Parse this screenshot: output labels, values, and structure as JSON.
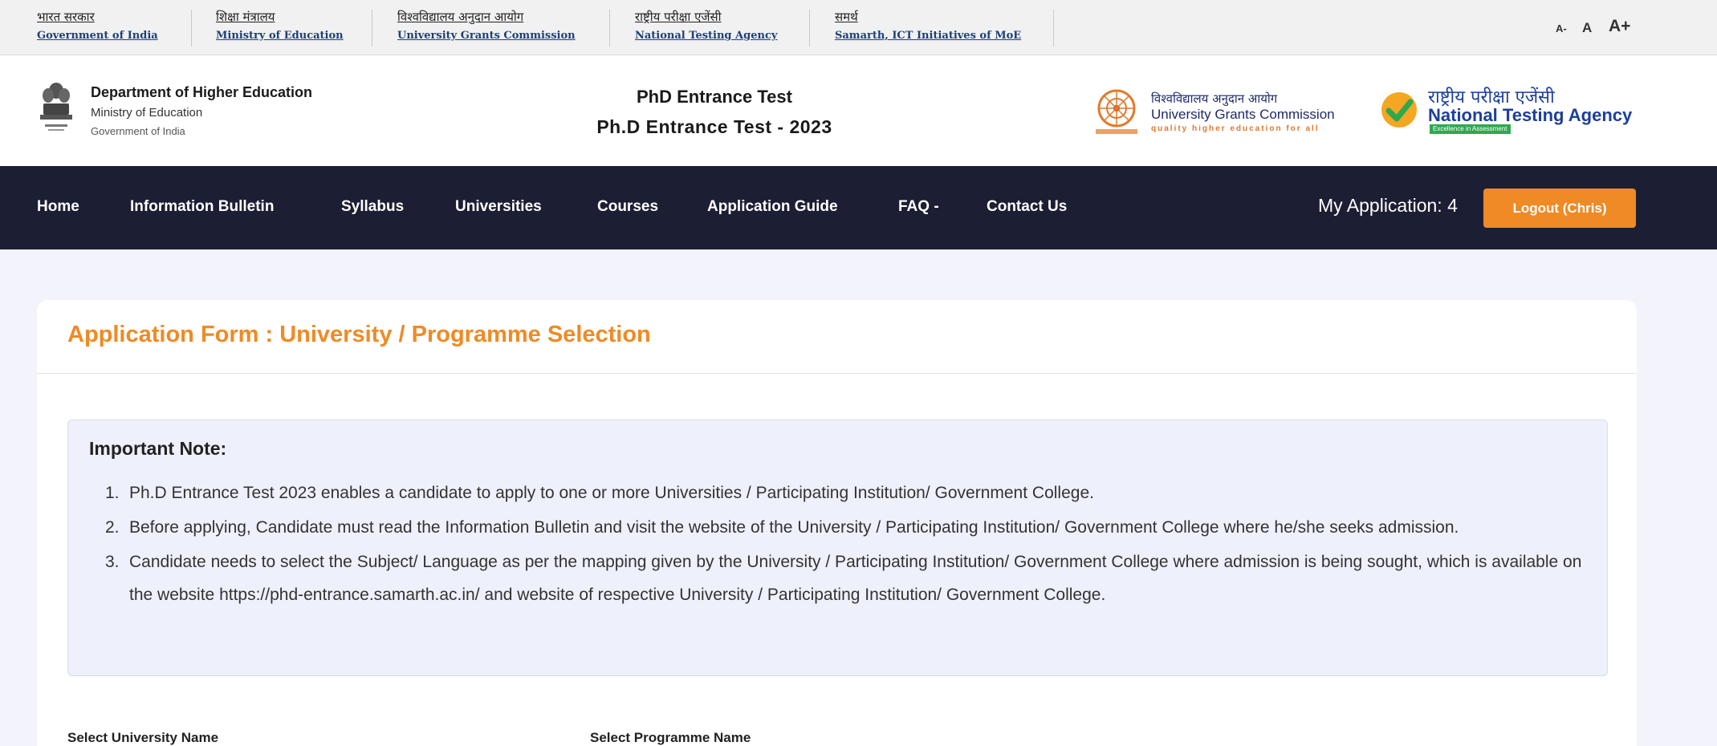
{
  "gov_links": [
    {
      "hi": "भारत सरकार",
      "en": "Government of India"
    },
    {
      "hi": "शिक्षा मंत्रालय",
      "en": "Ministry of Education"
    },
    {
      "hi": "विश्वविद्यालय अनुदान आयोग",
      "en": "University Grants Commission"
    },
    {
      "hi": "राष्ट्रीय परीक्षा एजेंसी",
      "en": "National Testing Agency"
    },
    {
      "hi": "समर्थ",
      "en": "Samarth, ICT Initiatives of MoE"
    }
  ],
  "font_controls": {
    "small": "A-",
    "normal": "A",
    "large": "A+"
  },
  "header": {
    "dept_title": "Department of Higher Education",
    "dept_ministry": "Ministry of Education",
    "dept_gov": "Government of India",
    "title_line1": "PhD Entrance Test",
    "title_line2": "Ph.D Entrance Test - 2023",
    "ugc_hi": "विश्वविद्यालय अनुदान आयोग",
    "ugc_en": "University Grants Commission",
    "ugc_tag": "quality higher education for all",
    "nta_hi": "राष्ट्रीय परीक्षा एजेंसी",
    "nta_en": "National Testing Agency",
    "nta_tag": "Excellence in Assessment"
  },
  "nav": {
    "items": [
      "Home",
      "Information Bulletin",
      "Syllabus",
      "Universities",
      "Courses",
      "Application Guide",
      "FAQ -",
      "Contact Us"
    ],
    "my_application": "My Application: 4",
    "logout": "Logout (Chris)"
  },
  "colors": {
    "accent": "#f08a24",
    "nav_bg": "#1c1e34",
    "note_bg": "#eef0fb"
  },
  "form": {
    "title": "Application Form : University / Programme Selection",
    "note_title": "Important Note:",
    "notes": [
      "Ph.D Entrance Test 2023 enables a candidate to apply to one or more Universities / Participating Institution/ Government College.",
      "Before applying, Candidate must read the Information Bulletin and visit the website of the University / Participating Institution/ Government College where he/she seeks admission.",
      "Candidate needs to select the Subject/ Language as per the mapping given by the University / Participating Institution/ Government College where admission is being sought, which is available on the website https://phd-entrance.samarth.ac.in/ and website of respective University / Participating Institution/ Government College."
    ],
    "university_label": "Select University Name",
    "programme_label": "Select Programme Name"
  }
}
